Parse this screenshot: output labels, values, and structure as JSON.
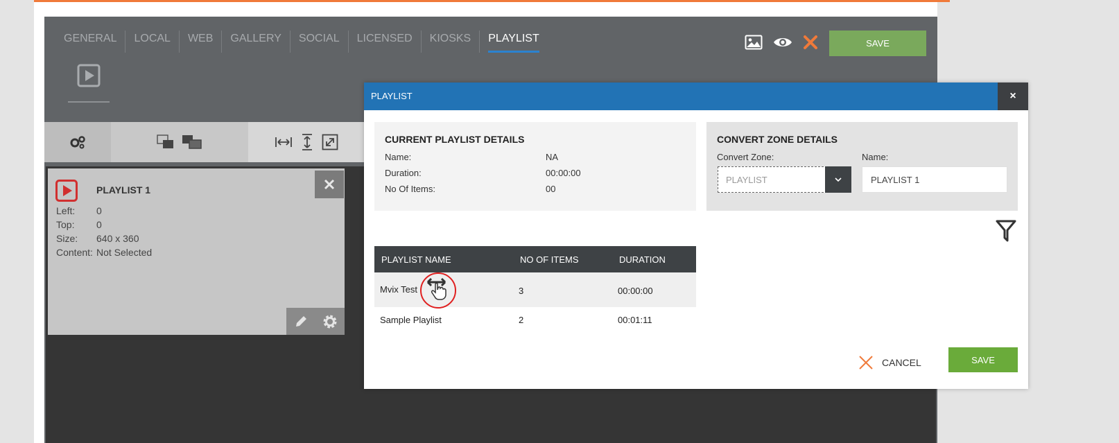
{
  "tabs": [
    "GENERAL",
    "LOCAL",
    "WEB",
    "GALLERY",
    "SOCIAL",
    "LICENSED",
    "KIOSKS",
    "PLAYLIST"
  ],
  "top_save_label": "SAVE",
  "zone": {
    "title": "PLAYLIST 1",
    "props": [
      {
        "label": "Left:",
        "value": "0"
      },
      {
        "label": "Top:",
        "value": "0"
      },
      {
        "label": "Size:",
        "value": "640 x 360"
      },
      {
        "label": "Content:",
        "value": "Not Selected"
      }
    ]
  },
  "modal": {
    "title": "PLAYLIST",
    "close_glyph": "×",
    "current": {
      "title": "CURRENT PLAYLIST DETAILS",
      "rows": [
        {
          "label": "Name:",
          "value": "NA"
        },
        {
          "label": "Duration:",
          "value": "00:00:00"
        },
        {
          "label": "No Of Items:",
          "value": "00"
        }
      ]
    },
    "convert": {
      "title": "CONVERT ZONE DETAILS",
      "zone_label": "Convert Zone:",
      "zone_value": "PLAYLIST",
      "name_label": "Name:",
      "name_value": "PLAYLIST 1"
    },
    "table": {
      "headers": [
        "PLAYLIST NAME",
        "NO OF ITEMS",
        "DURATION"
      ],
      "rows": [
        {
          "name": "Mvix Test",
          "items": "3",
          "duration": "00:00:00"
        },
        {
          "name": "Sample Playlist",
          "items": "2",
          "duration": "00:01:11"
        }
      ]
    },
    "cancel_label": "CANCEL",
    "save_label": "SAVE"
  },
  "colors": {
    "accent_orange": "#f07a3a",
    "header_blue": "#2273b5",
    "save_green": "#6aab3a",
    "top_save_green": "#7aa95c",
    "dark_panel": "#3e4245"
  }
}
